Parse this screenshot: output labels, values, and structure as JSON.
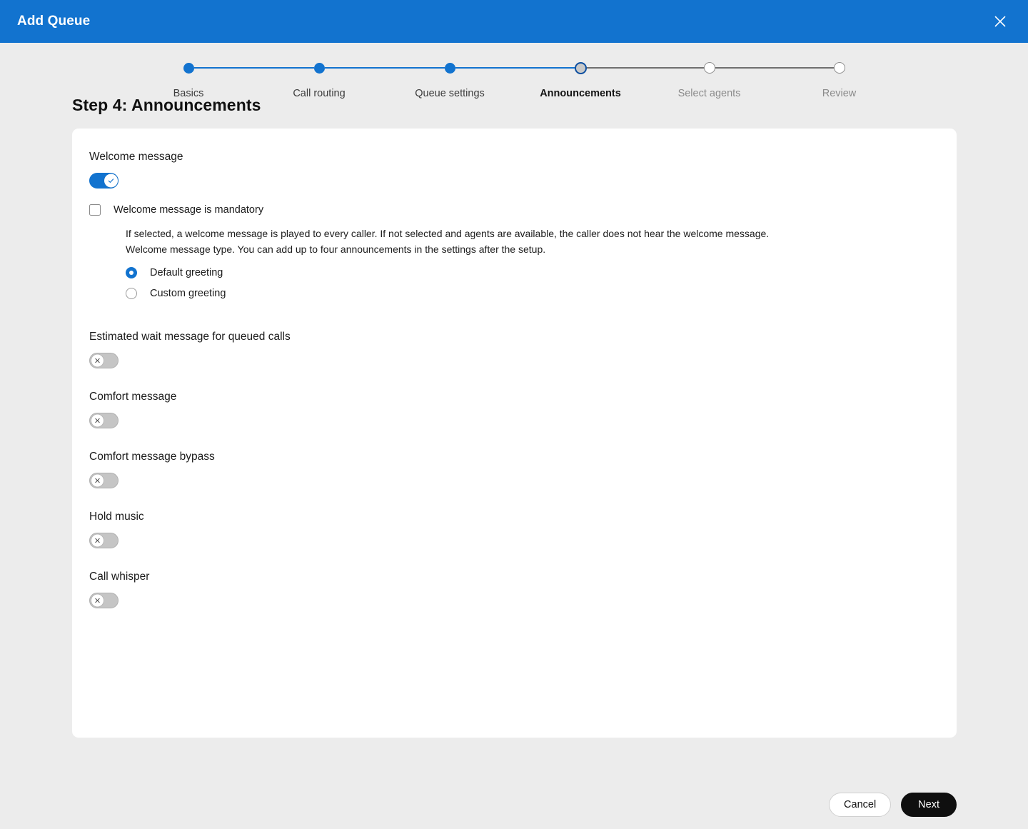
{
  "window": {
    "title": "Add Queue",
    "close_icon": "close-icon",
    "header_bg": "#1273cf"
  },
  "stepper": {
    "active_index": 3,
    "steps": [
      {
        "label": "Basics",
        "state": "done"
      },
      {
        "label": "Call routing",
        "state": "done"
      },
      {
        "label": "Queue settings",
        "state": "done"
      },
      {
        "label": "Announcements",
        "state": "current"
      },
      {
        "label": "Select agents",
        "state": "todo"
      },
      {
        "label": "Review",
        "state": "todo"
      }
    ],
    "done_color": "#1273cf",
    "todo_color": "#6f6f6f"
  },
  "page": {
    "title": "Step 4: Announcements"
  },
  "form": {
    "welcome_message": {
      "label": "Welcome message",
      "toggle_state": "on",
      "toggle_icon": "check-icon",
      "mandatory": {
        "label": "Welcome message is mandatory",
        "checked": false
      },
      "description_line_1": "If selected, a welcome message is played to every caller. If not selected and agents are available, the caller does not hear the welcome message.",
      "description_line_2": "Welcome message type. You can add up to four announcements in the settings after the setup.",
      "greeting_options": [
        {
          "label": "Default greeting",
          "selected": true
        },
        {
          "label": "Custom greeting",
          "selected": false
        }
      ]
    },
    "estimated_wait_message": {
      "label": "Estimated wait message for queued calls",
      "toggle_state": "off",
      "toggle_icon": "x-icon"
    },
    "comfort_message": {
      "label": "Comfort message",
      "toggle_state": "off",
      "toggle_icon": "x-icon"
    },
    "comfort_message_bypass": {
      "label": "Comfort message bypass",
      "toggle_state": "off",
      "toggle_icon": "x-icon"
    },
    "hold_music": {
      "label": "Hold music",
      "toggle_state": "off",
      "toggle_icon": "x-icon"
    },
    "call_whisper": {
      "label": "Call whisper",
      "toggle_state": "off",
      "toggle_icon": "x-icon"
    }
  },
  "footer": {
    "cancel_label": "Cancel",
    "next_label": "Next"
  }
}
